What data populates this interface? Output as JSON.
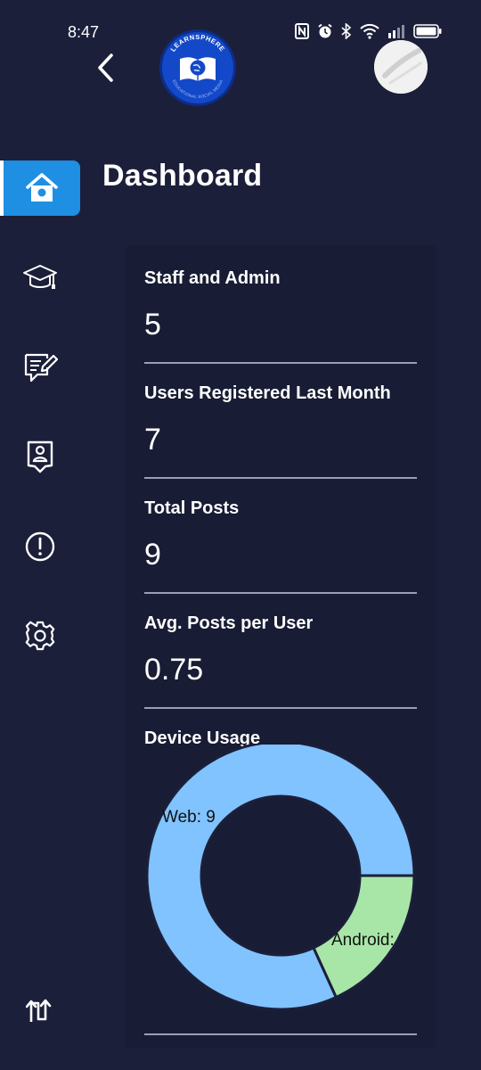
{
  "status_bar": {
    "time": "8:47"
  },
  "header": {
    "logo_text": "LEARNSPHERE",
    "logo_subtext": "EDUCATIONAL SOCIAL MEDIA"
  },
  "page": {
    "title": "Dashboard"
  },
  "stats": [
    {
      "label": "Staff and Admin",
      "value": "5"
    },
    {
      "label": "Users Registered Last Month",
      "value": "7"
    },
    {
      "label": "Total Posts",
      "value": "9"
    },
    {
      "label": "Avg. Posts per User",
      "value": "0.75"
    }
  ],
  "device_usage": {
    "title": "Device Usage"
  },
  "chart_data": {
    "type": "pie",
    "categories": [
      "Web",
      "Android"
    ],
    "values": [
      9,
      2
    ],
    "labels": [
      "Web: 9",
      "Android:"
    ],
    "colors": [
      "#80c3ff",
      "#a8e6a8"
    ]
  },
  "icons": [
    "home-icon",
    "graduation-cap-icon",
    "edit-note-icon",
    "contact-badge-icon",
    "alert-circle-icon",
    "gear-icon",
    "sort-arrows-icon"
  ]
}
